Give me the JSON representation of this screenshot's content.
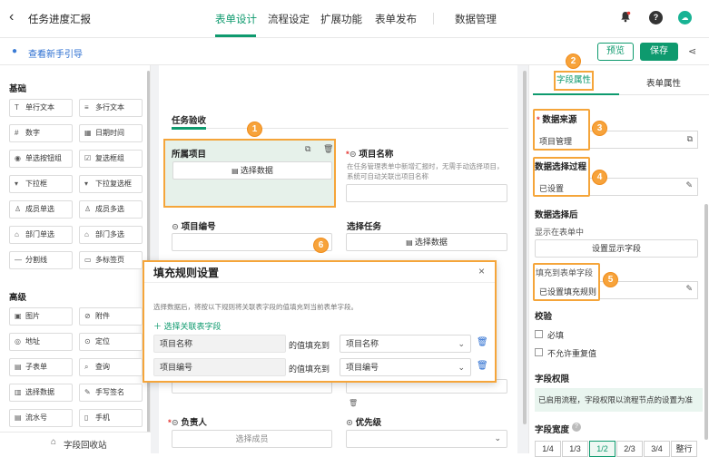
{
  "header": {
    "title": "任务进度汇报",
    "tabs": [
      "表单设计",
      "流程设定",
      "扩展功能",
      "表单发布"
    ],
    "data_manage": "数据管理",
    "guide": "查看新手引导",
    "preview": "预览",
    "save": "保存"
  },
  "left": {
    "basic_title": "基础",
    "basic": [
      {
        "l": "单行文本",
        "i": "T"
      },
      {
        "l": "多行文本",
        "i": "≡"
      },
      {
        "l": "数字",
        "i": "#"
      },
      {
        "l": "日期时间",
        "i": "▦"
      },
      {
        "l": "单选按钮组",
        "i": "◉"
      },
      {
        "l": "复选框组",
        "i": "☑"
      },
      {
        "l": "下拉框",
        "i": "▾"
      },
      {
        "l": "下拉复选框",
        "i": "▾"
      },
      {
        "l": "成员单选",
        "i": "♙"
      },
      {
        "l": "成员多选",
        "i": "♙"
      },
      {
        "l": "部门单选",
        "i": "⌂"
      },
      {
        "l": "部门多选",
        "i": "⌂"
      },
      {
        "l": "分割线",
        "i": "—"
      },
      {
        "l": "多标签页",
        "i": "▭"
      }
    ],
    "adv_title": "高级",
    "adv": [
      {
        "l": "图片",
        "i": "▣"
      },
      {
        "l": "附件",
        "i": "⊘"
      },
      {
        "l": "地址",
        "i": "◎"
      },
      {
        "l": "定位",
        "i": "⊙"
      },
      {
        "l": "子表单",
        "i": "▤"
      },
      {
        "l": "查询",
        "i": "⌕"
      },
      {
        "l": "选择数据",
        "i": "▥"
      },
      {
        "l": "手写签名",
        "i": "✎"
      },
      {
        "l": "流水号",
        "i": "▤"
      },
      {
        "l": "手机",
        "i": "▯"
      }
    ],
    "recycle": "字段回收站"
  },
  "form": {
    "tab": "任务验收",
    "f1": "所属项目",
    "f1_btn": "选择数据",
    "f2": "项目名称",
    "f2_hint": "在任务管理表单中新增汇报时，无需手动选择项目，系统可自动关联出项目名称",
    "f3": "项目编号",
    "f4": "选择任务",
    "f4_btn": "选择数据",
    "f5": "负责人",
    "f5_btn": "选择成员",
    "f6": "优先级"
  },
  "dialog": {
    "title": "填充规则设置",
    "desc": "选择数据后，将按以下规则将关联表字段的值填充到当前表单字段。",
    "add": "选择关联表字段",
    "rows": [
      {
        "src": "项目名称",
        "mid": "的值填充到",
        "dst": "项目名称"
      },
      {
        "src": "项目编号",
        "mid": "的值填充到",
        "dst": "项目编号"
      }
    ]
  },
  "right": {
    "tabs": [
      "字段属性",
      "表单属性"
    ],
    "source_label": "数据来源",
    "source_value": "项目管理",
    "process_label": "数据选择过程",
    "process_value": "已设置",
    "after_label": "数据选择后",
    "show_label": "显示在表单中",
    "show_btn": "设置显示字段",
    "fill_label": "填充到表单字段",
    "fill_value": "已设置填充规则",
    "validate_label": "校验",
    "req": "必填",
    "nodup": "不允许重复值",
    "perm_label": "字段权限",
    "perm_text": "已启用流程，字段权限以流程节点的设置为准",
    "width_label": "字段宽度",
    "widths": [
      "1/4",
      "1/3",
      "1/2",
      "2/3",
      "3/4",
      "整行"
    ]
  },
  "badges": [
    "1",
    "2",
    "3",
    "4",
    "5",
    "6"
  ],
  "colors": {
    "accent": "#0e9a6e",
    "orange": "#f5a53a",
    "selected_field_bg": "#e6f1ea"
  }
}
